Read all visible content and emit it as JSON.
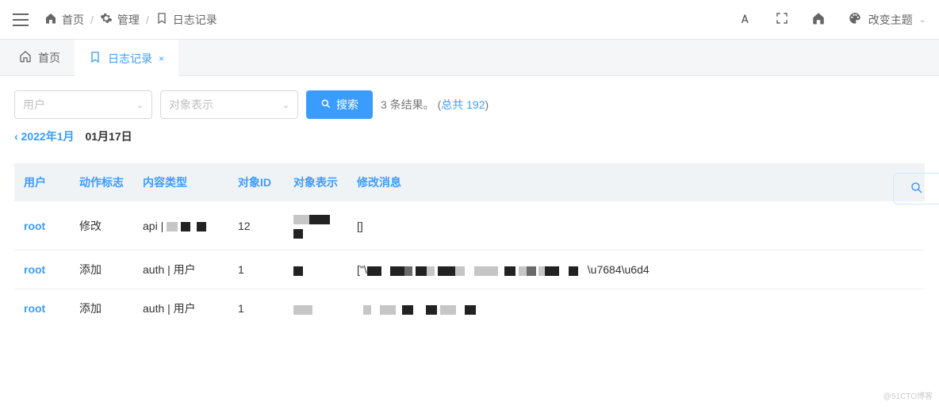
{
  "breadcrumb": {
    "home": "首页",
    "admin": "管理",
    "log": "日志记录"
  },
  "theme_label": "改变主题",
  "tabs": {
    "home": "首页",
    "log": "日志记录"
  },
  "filters": {
    "user_placeholder": "用户",
    "repr_placeholder": "对象表示",
    "search_label": "搜索"
  },
  "results": {
    "count_text": "3 条结果。",
    "total_prefix": "(",
    "total_label": "总共 192",
    "total_suffix": ")"
  },
  "date_nav": {
    "prev": "‹ 2022年1月",
    "current": "01月17日"
  },
  "columns": {
    "user": "用户",
    "action": "动作标志",
    "content_type": "内容类型",
    "object_id": "对象ID",
    "object_repr": "对象表示",
    "change_msg": "修改消息"
  },
  "rows": [
    {
      "user": "root",
      "action": "修改",
      "content_type": "api |",
      "object_id": "12",
      "change_msg": "[]"
    },
    {
      "user": "root",
      "action": "添加",
      "content_type": "auth | 用户",
      "object_id": "1",
      "change_msg_suffix": "\\u7684\\u6d4"
    },
    {
      "user": "root",
      "action": "添加",
      "content_type": "auth | 用户",
      "object_id": "1"
    }
  ],
  "row1_msg_prefix": "[\"\\",
  "watermark": "@51CTO博客"
}
